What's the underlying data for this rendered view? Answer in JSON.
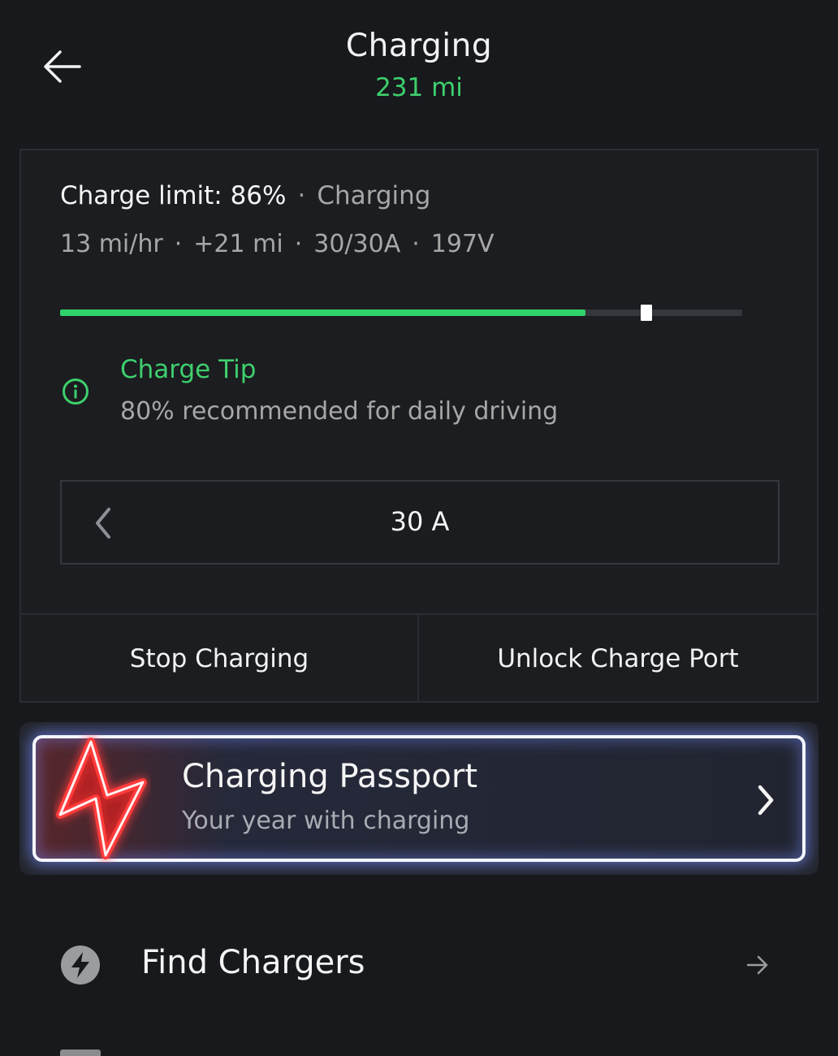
{
  "header": {
    "title": "Charging",
    "range": "231 mi"
  },
  "charge_card": {
    "limit_label": "Charge limit: 86%",
    "separator": "·",
    "state": "Charging",
    "stats": {
      "rate": "13 mi/hr",
      "added": "+21 mi",
      "current": "30/30A",
      "voltage": "197V"
    },
    "charge_progress": {
      "current_level_fraction": 0.77,
      "limit_fraction": 0.86
    },
    "tip": {
      "title": "Charge Tip",
      "text": "80% recommended for daily driving"
    },
    "amperage": {
      "value": "30 A"
    },
    "actions": {
      "stop_label": "Stop Charging",
      "unlock_label": "Unlock Charge Port"
    }
  },
  "passport": {
    "title": "Charging Passport",
    "subtitle": "Your year with charging"
  },
  "menu": {
    "find_chargers": "Find Chargers"
  },
  "colors": {
    "accent_green": "#3ecf6e",
    "bar_green": "#2ed36a",
    "background": "#17191c"
  }
}
